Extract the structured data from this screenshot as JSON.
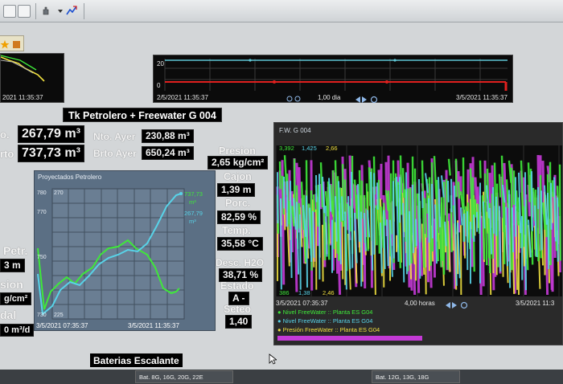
{
  "colors": {
    "panel_bg": "#0b0b0b",
    "value_text": "#f2f2f2",
    "proj_bg": "#5b6f84",
    "series_green": "#3fe83a",
    "series_cyan": "#58d3e8",
    "series_magenta": "#c43ad6",
    "series_yellow": "#f0e040",
    "trend_red": "#e0201e",
    "trend_cyan": "#5ec6d4"
  },
  "top_trend": {
    "left_timestamp": "2021 11:35:37",
    "left_value_label": "",
    "y_top": "20",
    "y_bottom": "0",
    "start_time": "2/5/2021 11:35:37",
    "end_time": "3/5/2021 11:35:37",
    "span": "1,00 dia"
  },
  "tank": {
    "title": "Tk Petrolero + Freewater G 004",
    "neto_label": "o.",
    "neto_value": "267,79 m³",
    "bruto_label": "rto",
    "bruto_value": "737,73 m³",
    "neto_ayer_label": "Nto. Ayer",
    "neto_ayer_value": "230,88 m³",
    "bruto_ayer_label": "Brto Ayer",
    "bruto_ayer_value": "650,24 m³"
  },
  "left_partial": {
    "petr_label": "Petr.",
    "petr_value": "3 m",
    "presion_label": "sion",
    "presion_value": "g/cm²",
    "caudal_label": "dal",
    "caudal_value": "0 m³/d"
  },
  "readings": {
    "presion_label": "Presion",
    "presion_value": "2,65 kg/cm²",
    "cajon_label": "Cajon",
    "cajon_value": "1,39 m",
    "porc_label": "Porc.",
    "porc_value": "82,59 %",
    "temp_label": "Temp.",
    "temp_value": "35,58 °C",
    "desc_label": "Desc. H2O",
    "desc_value": "38,71 %",
    "estado_label": "Estado",
    "estado_value": "A -",
    "seteo_label": "Seteo",
    "seteo_value": "1,40"
  },
  "proj_chart": {
    "title": "Proyectados Petrolero",
    "y_labels_left": [
      "780",
      "770",
      "750",
      "730"
    ],
    "y_labels_right": [
      "270",
      "225"
    ],
    "end_value_1": "737,73",
    "end_unit_1": "m³",
    "end_value_2": "267,79",
    "end_unit_2": "m³",
    "start_time": "3/5/2021 07:35:37",
    "end_time": "3/5/2021 11:35:37"
  },
  "fw_chart": {
    "title": "F.W. G 004",
    "top_values": [
      "3,392",
      "1,425",
      "2,66"
    ],
    "bottom_values": [
      "386",
      "1,38",
      "2,46"
    ],
    "start_time": "3/5/2021 07:35:37",
    "span": "4,00 horas",
    "end_time": "3/5/2021 11:3",
    "legend": [
      "Nivel FreeWater :: Planta ES G04",
      "Nivel FreeWater :: Planta ES G04",
      "Presión FreeWater :: Planta ES G04"
    ]
  },
  "bottom": {
    "escalante_label": "Baterias Escalante",
    "bat_tab_1": "Bat. 8G, 16G, 20G, 22E",
    "bat_tab_2": "Bat. 12G, 13G, 18G"
  }
}
